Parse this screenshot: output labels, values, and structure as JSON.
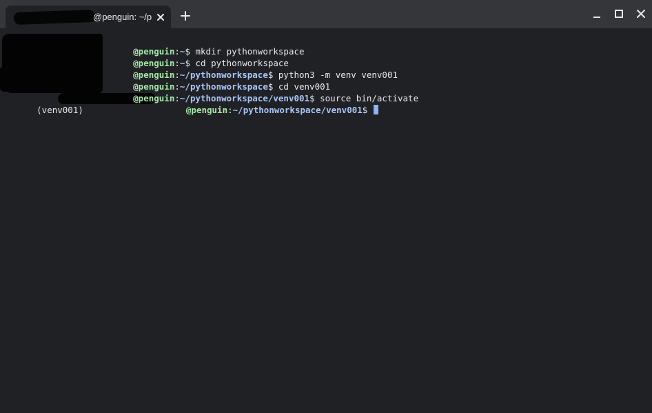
{
  "tab": {
    "title": "@penguin: ~/p",
    "close_icon": "close-icon"
  },
  "toolbar": {
    "new_tab_icon": "plus-icon",
    "minimize_icon": "minimize-icon",
    "maximize_icon": "maximize-icon",
    "close_icon": "close-icon"
  },
  "colors": {
    "background": "#202124",
    "titlebar": "#35363a",
    "host": "#a5e8a9",
    "path": "#a8c7fa",
    "text": "#e8eaed",
    "cursor": "#8ab4f8"
  },
  "terminal": {
    "lines": [
      {
        "host": "@penguin",
        "sep": ":",
        "path": "~",
        "prompt": "$ ",
        "command": "mkdir pythonworkspace"
      },
      {
        "host": "@penguin",
        "sep": ":",
        "path": "~",
        "prompt": "$ ",
        "command": "cd pythonworkspace"
      },
      {
        "host": "@penguin",
        "sep": ":",
        "path": "~/pythonworkspace",
        "prompt": "$ ",
        "command": "python3 -m venv venv001"
      },
      {
        "host": "@penguin",
        "sep": ":",
        "path": "~/pythonworkspace",
        "prompt": "$ ",
        "command": "cd venv001"
      },
      {
        "host": "@penguin",
        "sep": ":",
        "path": "~/pythonworkspace/venv001",
        "prompt": "$ ",
        "command": "source bin/activate"
      },
      {
        "prefix": "(venv001)",
        "host": "@penguin",
        "sep": ":",
        "path": "~/pythonworkspace/venv001",
        "prompt": "$ ",
        "command": ""
      }
    ]
  }
}
